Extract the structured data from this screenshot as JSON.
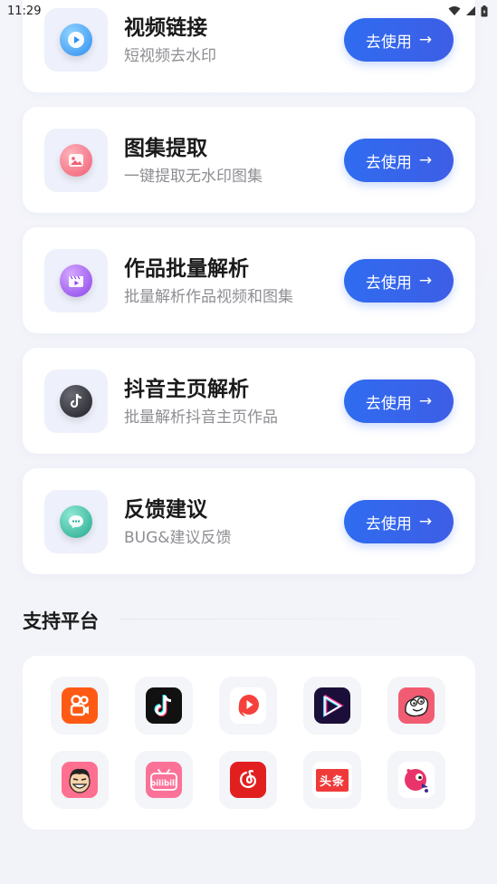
{
  "status_bar": {
    "time": "11:29"
  },
  "cards": [
    {
      "title": "视频链接",
      "subtitle": "短视频去水印",
      "button": "去使用",
      "arrow": "→",
      "icon": "video-play-icon",
      "color": "#3aa0f0"
    },
    {
      "title": "图集提取",
      "subtitle": "一键提取无水印图集",
      "button": "去使用",
      "arrow": "→",
      "icon": "image-icon",
      "color": "#f36b7f"
    },
    {
      "title": "作品批量解析",
      "subtitle": "批量解析作品视频和图集",
      "button": "去使用",
      "arrow": "→",
      "icon": "clapper-icon",
      "color": "#9b5cf0"
    },
    {
      "title": "抖音主页解析",
      "subtitle": "批量解析抖音主页作品",
      "button": "去使用",
      "arrow": "→",
      "icon": "douyin-icon",
      "color": "#2b2b33"
    },
    {
      "title": "反馈建议",
      "subtitle": "BUG&建议反馈",
      "button": "去使用",
      "arrow": "→",
      "icon": "chat-icon",
      "color": "#2fb39a"
    }
  ],
  "section": {
    "title": "支持平台"
  },
  "platforms": [
    {
      "name": "kuaishou-logo",
      "color": "#ff5a14"
    },
    {
      "name": "douyin-logo",
      "color": "#111111"
    },
    {
      "name": "weishi-logo",
      "color": "#ffffff"
    },
    {
      "name": "video-logo",
      "color": "#1b0f3a"
    },
    {
      "name": "pipixia-logo",
      "color": "#f25c73"
    },
    {
      "name": "zuiyou-logo",
      "color": "#ff6f8f"
    },
    {
      "name": "bilibili-logo",
      "color": "#fb7299"
    },
    {
      "name": "netease-music-logo",
      "color": "#e21f1f"
    },
    {
      "name": "toutiao-logo",
      "text": "头条",
      "color": "#f03a3a"
    },
    {
      "name": "bird-logo",
      "color": "#e8346a"
    }
  ]
}
